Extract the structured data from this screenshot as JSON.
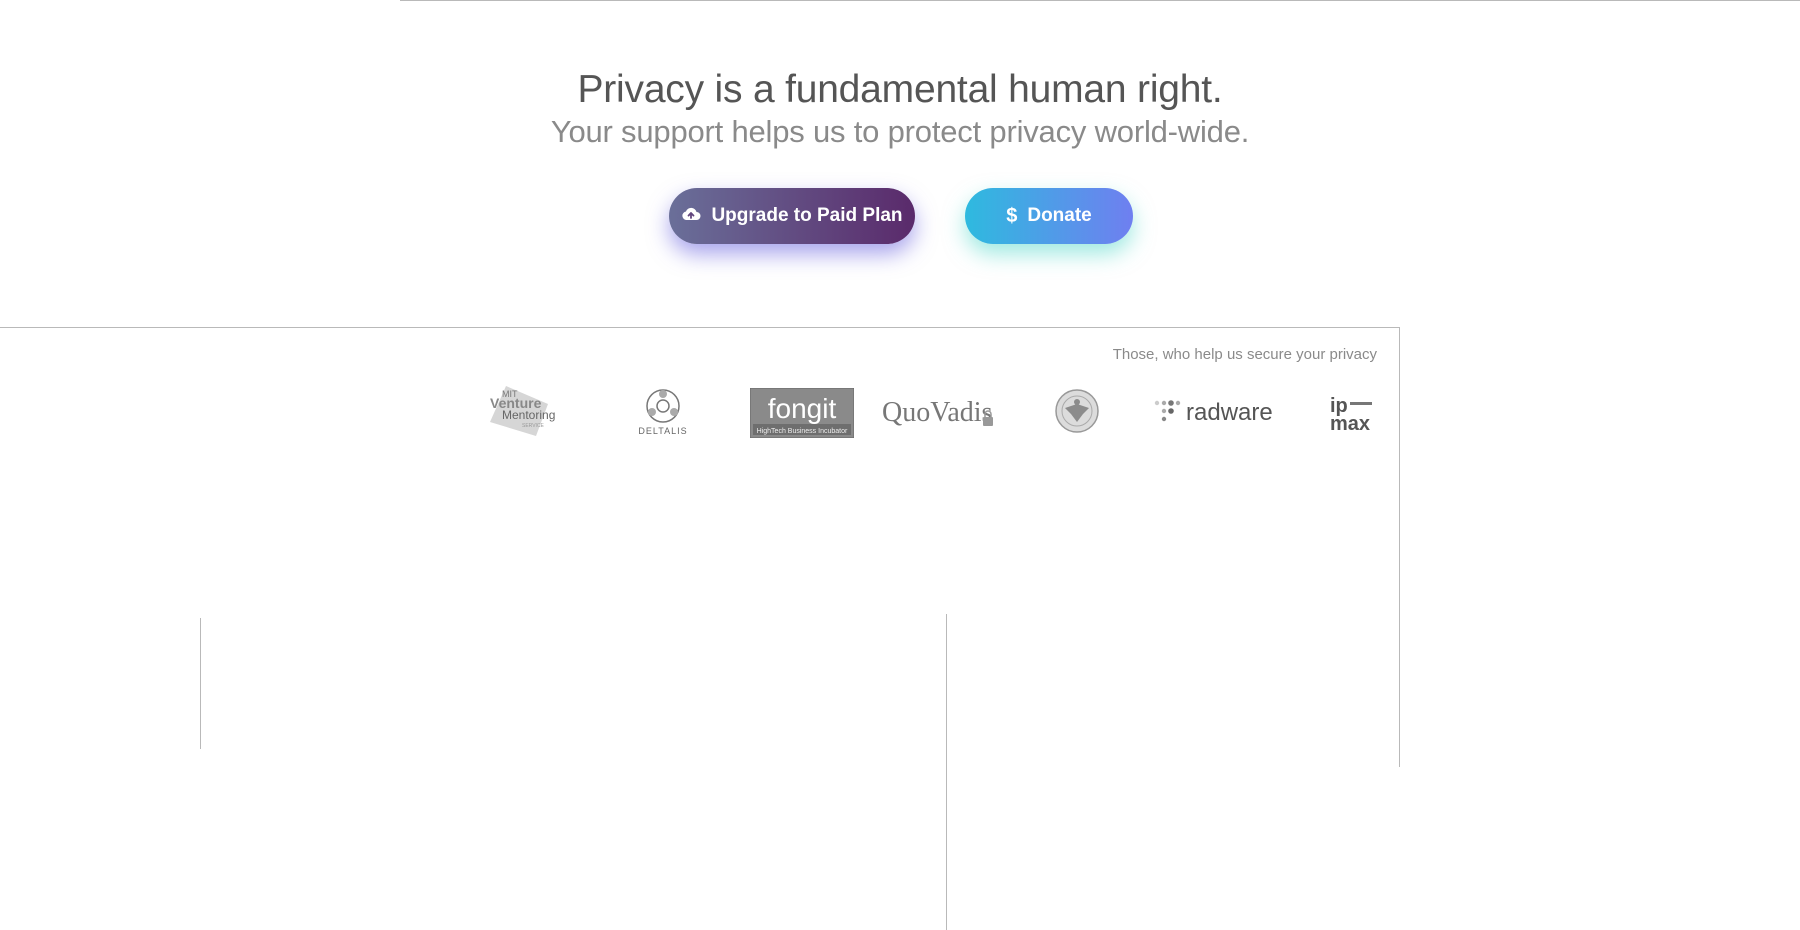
{
  "hero": {
    "title": "Privacy is a fundamental human right.",
    "subtitle": "Your support helps us to protect privacy world-wide."
  },
  "actions": {
    "upgrade_label": "Upgrade to Paid Plan",
    "upgrade_icon": "cloud-upload-icon",
    "donate_label": "Donate",
    "donate_icon": "dollar-icon"
  },
  "supporters": {
    "caption": "Those, who help us secure your privacy",
    "logos": [
      {
        "name": "mit-venture-mentoring-service",
        "line1": "MIT",
        "line2": "Venture",
        "line3": "Mentoring",
        "line4": "SERVICE"
      },
      {
        "name": "deltalis",
        "text": "DELTALIS"
      },
      {
        "name": "fongit",
        "text": "fongit",
        "tagline": "HighTech Business Incubator"
      },
      {
        "name": "quovadis",
        "text": "QuoVadis"
      },
      {
        "name": "seal",
        "text": ""
      },
      {
        "name": "radware",
        "text": "radware"
      },
      {
        "name": "ipmax",
        "line1": "ip",
        "line2": "max"
      }
    ]
  },
  "colors": {
    "upgrade_start": "#6a6f99",
    "upgrade_end": "#5a2a6b",
    "donate_start": "#2ebadf",
    "donate_end": "#6f7ff0"
  }
}
